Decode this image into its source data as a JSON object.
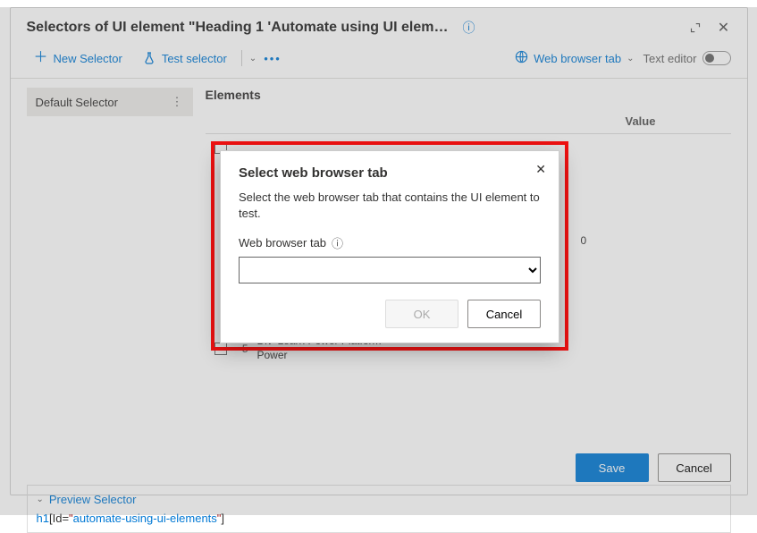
{
  "title": "Selectors of UI element \"Heading 1 'Automate using UI elemen...",
  "toolbar": {
    "new_selector": "New Selector",
    "test_selector": "Test selector",
    "web_browser_tab": "Web browser tab",
    "text_editor": "Text editor"
  },
  "sidebar": {
    "items": [
      {
        "label": "Default Selector"
      }
    ]
  },
  "elements": {
    "heading": "Elements",
    "columns": {
      "value": "Value"
    },
    "rows": [
      {
        "index": 5,
        "text": "Div 'Learn Power Platform Power",
        "value": "0"
      }
    ]
  },
  "preview": {
    "label": "Preview Selector",
    "code_tag": "h1",
    "code_attr": "Id",
    "code_val": "automate-using-ui-elements"
  },
  "footer": {
    "save": "Save",
    "cancel": "Cancel"
  },
  "modal": {
    "title": "Select web browser tab",
    "body": "Select the web browser tab that contains the UI element to test.",
    "field_label": "Web browser tab",
    "ok": "OK",
    "cancel": "Cancel"
  }
}
